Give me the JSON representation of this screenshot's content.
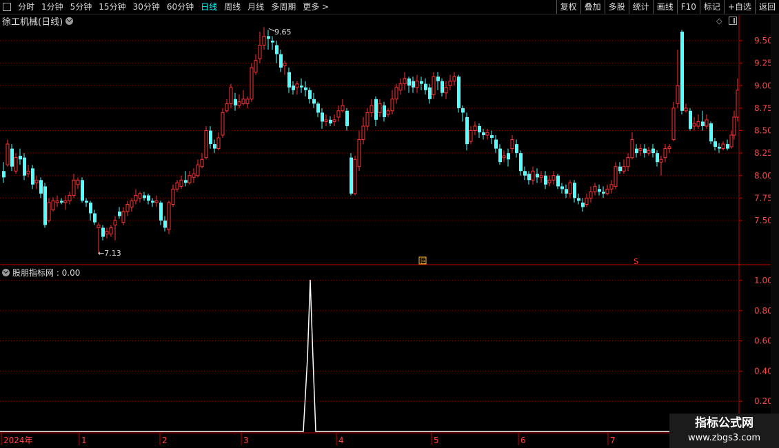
{
  "toolbar": {
    "periods": [
      "分时",
      "1分钟",
      "5分钟",
      "15分钟",
      "30分钟",
      "60分钟",
      "日线",
      "周线",
      "月线",
      "多周期",
      "更多 >"
    ],
    "active_index": 6,
    "buttons": [
      "复权",
      "叠加",
      "多股",
      "统计",
      "画线",
      "F10",
      "标记",
      "+自选",
      "返回"
    ]
  },
  "chart": {
    "title": "徐工机械(日线)",
    "high_label": "9.65",
    "low_label": "7.13",
    "price_ticks": [
      "9.50",
      "9.25",
      "9.00",
      "8.75",
      "8.50",
      "8.25",
      "8.00",
      "7.75",
      "7.50"
    ],
    "markers": {
      "square": "回",
      "s_mark": "S"
    },
    "colors": {
      "up": "#ff3232",
      "down": "#54ffff",
      "grid": "#8b0000",
      "axis_text": "#ff4444"
    }
  },
  "indicator": {
    "title": "股朋指标网 : 0.00",
    "ticks": [
      "1.00",
      "0.80",
      "0.60",
      "0.40",
      "0.20"
    ]
  },
  "time_axis": {
    "labels": [
      "2024年",
      "1",
      "2",
      "3",
      "4",
      "5",
      "6",
      "7"
    ]
  },
  "watermark": {
    "line1": "指标公式网",
    "line2": "www.zbgs3.com"
  }
}
